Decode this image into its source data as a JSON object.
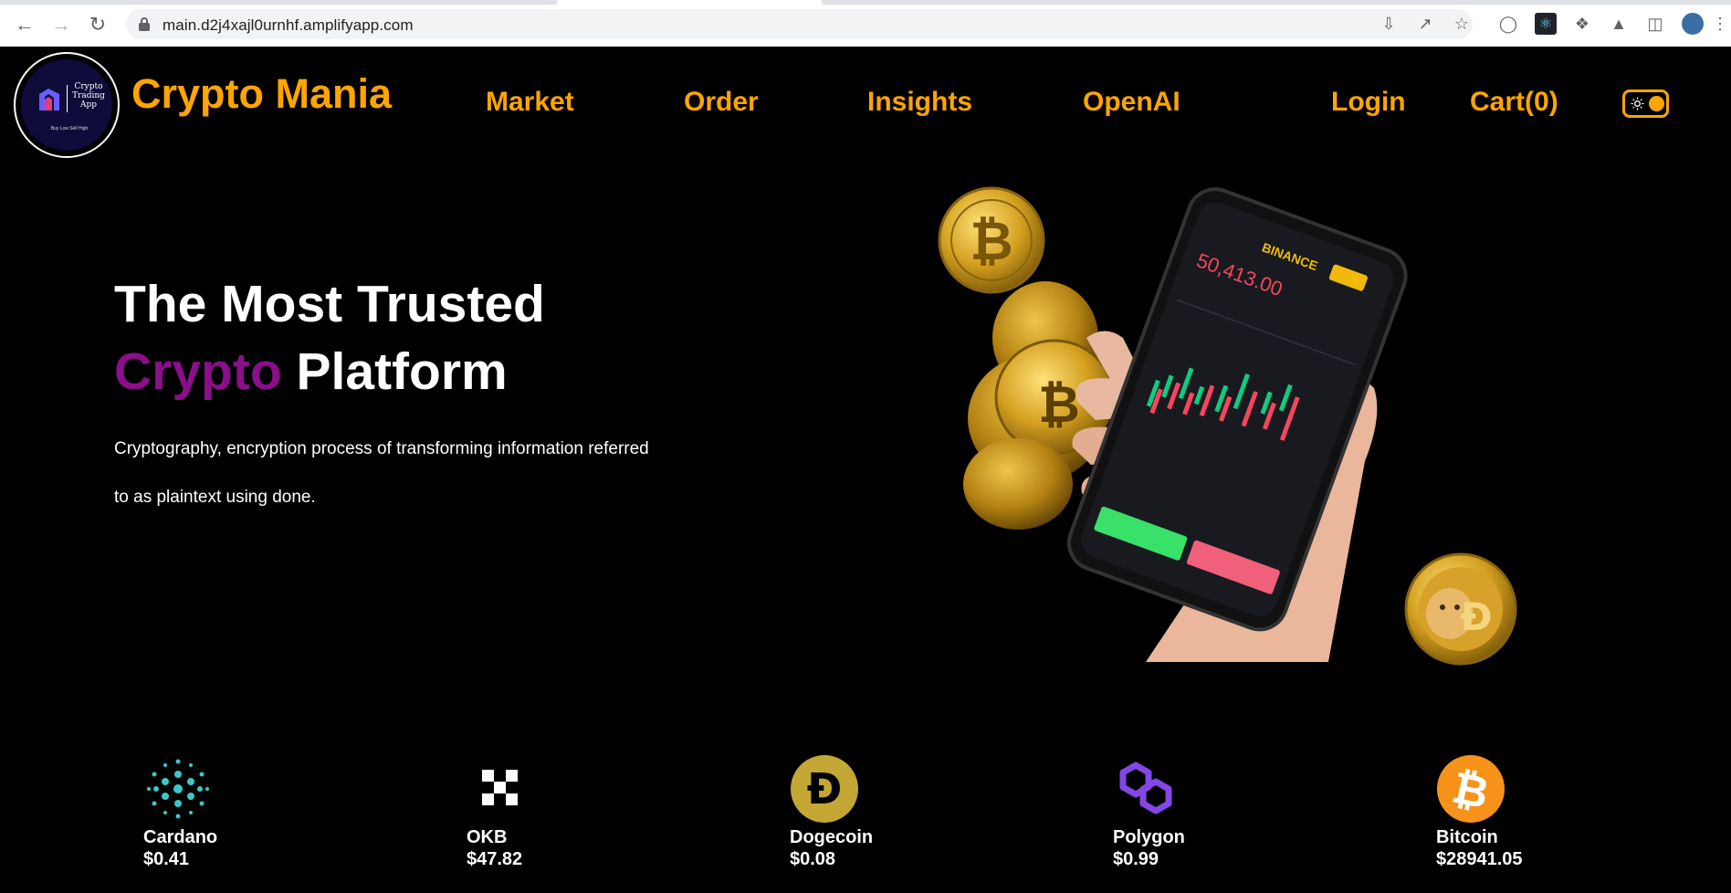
{
  "browser": {
    "url": "main.d2j4xajl0urnhf.amplifyapp.com"
  },
  "logo": {
    "line1": "Crypto",
    "line2": "Trading",
    "line3": "App",
    "tagline": "Buy Low Sell High"
  },
  "header": {
    "brand": "Crypto Mania",
    "nav": {
      "market": "Market",
      "order": "Order",
      "insights": "Insights",
      "openai": "OpenAI",
      "login": "Login",
      "cart": "Cart(0)"
    }
  },
  "hero": {
    "title_line1": "The Most Trusted",
    "title_accent": "Crypto",
    "title_line2_rest": " Platform",
    "description": "Cryptography, encryption process of transforming information referred to as plaintext using done.",
    "phone_exchange": "BINANCE",
    "phone_price": "50,413.00"
  },
  "coins": [
    {
      "name": "Cardano",
      "price": "$0.41"
    },
    {
      "name": "OKB",
      "price": "$47.82"
    },
    {
      "name": "Dogecoin",
      "price": "$0.08"
    },
    {
      "name": "Polygon",
      "price": "$0.99"
    },
    {
      "name": "Bitcoin",
      "price": "$28941.05"
    }
  ],
  "colors": {
    "accent": "#ffa500",
    "purple": "#8b0e8b",
    "background": "#000000"
  }
}
